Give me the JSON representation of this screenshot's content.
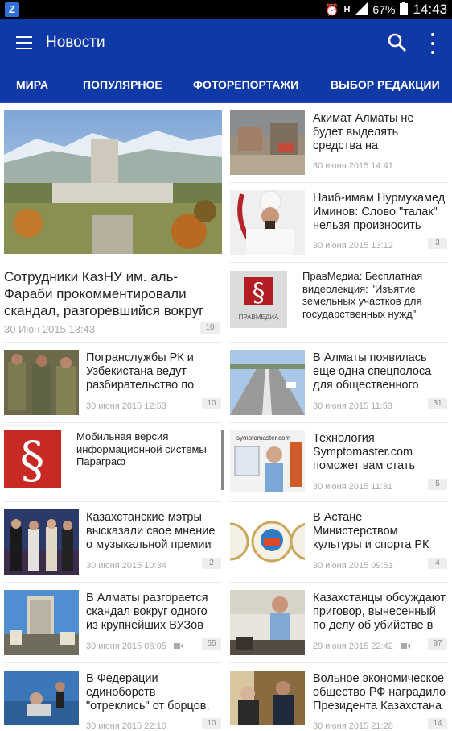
{
  "status": {
    "app_icon": "Z",
    "battery": "67%",
    "time": "14:43"
  },
  "appbar": {
    "title": "Новости"
  },
  "tabs": [
    "МИРА",
    "ПОПУЛЯРНОЕ",
    "ФОТОРЕПОРТАЖИ",
    "ВЫБОР РЕДАКЦИИ"
  ],
  "featured": {
    "title": "Сотрудники КазНУ им. аль-Фараби прокомментировали скандал, разгоревшийся вокруг",
    "date": "30 Июн 2015 13:43",
    "count": "10"
  },
  "left_news": [
    {
      "title": "Погранслужбы РК и Узбекистана ведут разбирательство по",
      "date": "30 июня 2015 12:53",
      "count": "10"
    },
    {
      "title": "Мобильная версия информационной системы Параграф"
    },
    {
      "title": "Казахстанские мэтры высказали свое мнение о музыкальной премии",
      "date": "30 июня 2015 10:34",
      "count": "2"
    },
    {
      "title": "В Алматы разгорается скандал вокруг одного из крупнейших ВУЗов",
      "date": "30 июня 2015 06:05",
      "count": "65"
    },
    {
      "title": "В Федерации единоборств \"отреклись\" от борцов, устроивших",
      "date": "30 июня 2015 22:10",
      "count": "10"
    }
  ],
  "right_news": [
    {
      "title": "Акимат Алматы не будет выделять средства на",
      "date": "30 июня 2015 14:41"
    },
    {
      "title": "Наиб-имам Нурмухамед Иминов: Слово \"талак\" нельзя произносить",
      "date": "30 июня 2015 13:12",
      "count": "3"
    },
    {
      "title": "ПравМедиа: Бесплатная видеолекция: \"Изъятие земельных участков для государственных нужд\""
    },
    {
      "title": "В Алматы появилась еще одна спецполоса для общественного",
      "date": "30 июня 2015 11:53",
      "count": "31"
    },
    {
      "title": "Технология Symptomaster.com поможет вам стать",
      "date": "30 июня 2015 11:31",
      "count": "5"
    },
    {
      "title": "В Астане Министерством культуры и спорта РК",
      "date": "30 июня 2015 09:51",
      "count": "4"
    },
    {
      "title": "Казахстанцы обсуждают приговор, вынесенный по делу об убийстве в",
      "date": "29 июня 2015 22:42",
      "count": "97"
    },
    {
      "title": "Вольное экономическое общество РФ наградило Президента Казахстана",
      "date": "30 июня 2015 21:28",
      "count": "14"
    }
  ],
  "thumb_text": {
    "pravmedia": "ПРАВМЕДИА",
    "sympto": "symptomaster.com"
  }
}
